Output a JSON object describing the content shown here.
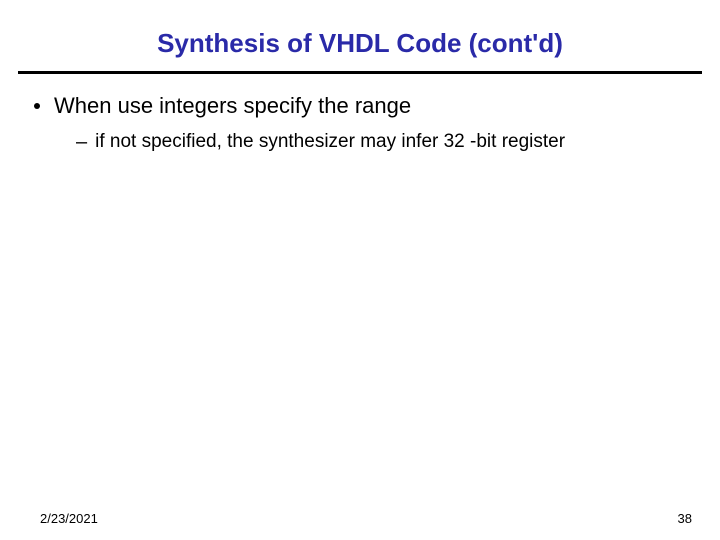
{
  "title": "Synthesis of VHDL Code (cont'd)",
  "bullets": {
    "l1": {
      "text": "When use integers specify the range"
    },
    "l2": {
      "text": "if not specified, the synthesizer may infer 32 -bit register"
    }
  },
  "footer": {
    "date": "2/23/2021",
    "page": "38"
  }
}
